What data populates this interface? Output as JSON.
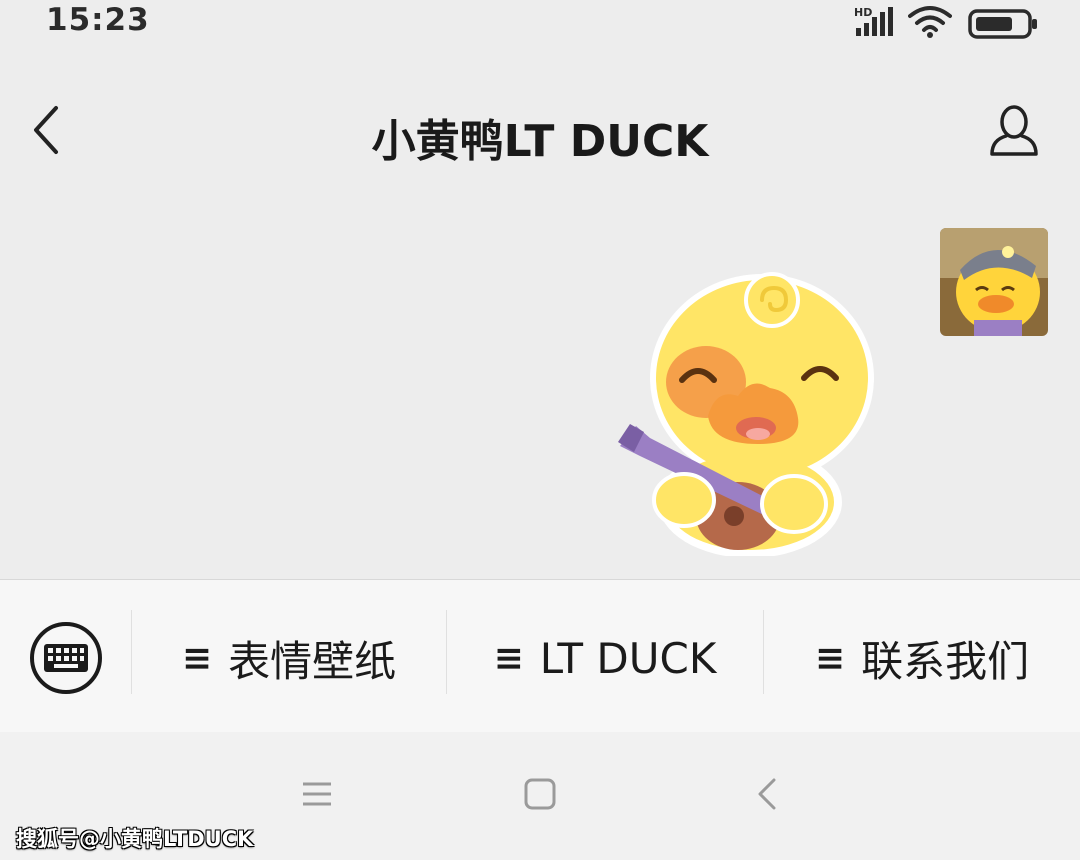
{
  "status_bar": {
    "time": "15:23",
    "network_label": "HD",
    "battery_level": 0.75
  },
  "nav": {
    "title": "小黄鸭LT DUCK",
    "back_icon": "chevron-left-icon",
    "profile_icon": "person-icon"
  },
  "chat": {
    "sender_avatar": "duck-avatar",
    "message_sticker": "duck-guitar-sticker"
  },
  "menu": {
    "keyboard_icon": "keyboard-icon",
    "items": [
      {
        "icon": "≡",
        "label": "表情壁纸"
      },
      {
        "icon": "≡",
        "label": "LT DUCK"
      },
      {
        "icon": "≡",
        "label": "联系我们"
      }
    ]
  },
  "system_nav": {
    "buttons": [
      "menu-icon",
      "home-icon",
      "back-icon"
    ]
  },
  "watermark": "搜狐号@小黄鸭LTDUCK",
  "colors": {
    "background": "#ededed",
    "menu_bar": "#f7f7f7",
    "duck_yellow": "#ffe566",
    "beak_orange": "#f59a3c",
    "guitar_purple": "#9b7fc4"
  }
}
